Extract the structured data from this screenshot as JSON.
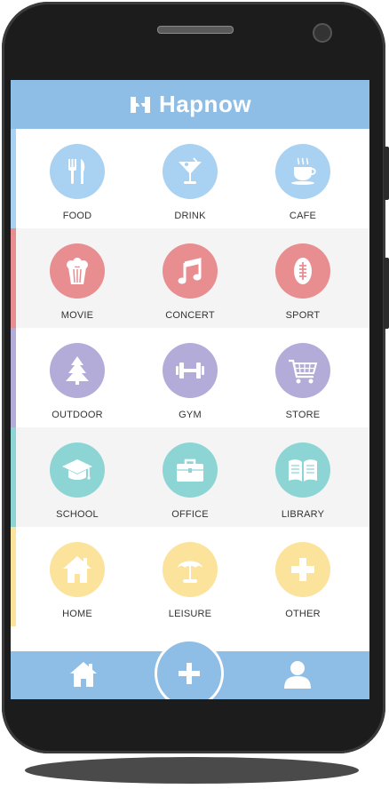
{
  "app": {
    "title": "Hapnow",
    "logo_text": "H"
  },
  "colors": {
    "header": "#8ebde5",
    "blue": "#a9d1f1",
    "red": "#e88e90",
    "purple": "#b4acd8",
    "teal": "#8dd5d4",
    "yellow": "#fbe39c"
  },
  "rows": [
    {
      "tone": "blue",
      "items": [
        {
          "label": "FOOD",
          "icon": "fork-knife-icon"
        },
        {
          "label": "DRINK",
          "icon": "cocktail-icon"
        },
        {
          "label": "CAFE",
          "icon": "coffee-cup-icon"
        }
      ]
    },
    {
      "tone": "red",
      "items": [
        {
          "label": "MOVIE",
          "icon": "popcorn-icon"
        },
        {
          "label": "CONCERT",
          "icon": "music-note-icon"
        },
        {
          "label": "SPORT",
          "icon": "football-icon"
        }
      ]
    },
    {
      "tone": "purple",
      "items": [
        {
          "label": "OUTDOOR",
          "icon": "tree-icon"
        },
        {
          "label": "GYM",
          "icon": "dumbbell-icon"
        },
        {
          "label": "STORE",
          "icon": "shopping-cart-icon"
        }
      ]
    },
    {
      "tone": "teal",
      "items": [
        {
          "label": "SCHOOL",
          "icon": "graduation-cap-icon"
        },
        {
          "label": "OFFICE",
          "icon": "briefcase-icon"
        },
        {
          "label": "LIBRARY",
          "icon": "open-book-icon"
        }
      ]
    },
    {
      "tone": "yellow",
      "items": [
        {
          "label": "HOME",
          "icon": "house-icon"
        },
        {
          "label": "LEISURE",
          "icon": "beach-umbrella-icon"
        },
        {
          "label": "OTHER",
          "icon": "plus-icon"
        }
      ]
    }
  ],
  "bottom_nav": {
    "home_icon": "home-icon",
    "add_icon": "plus-icon",
    "profile_icon": "user-icon"
  }
}
